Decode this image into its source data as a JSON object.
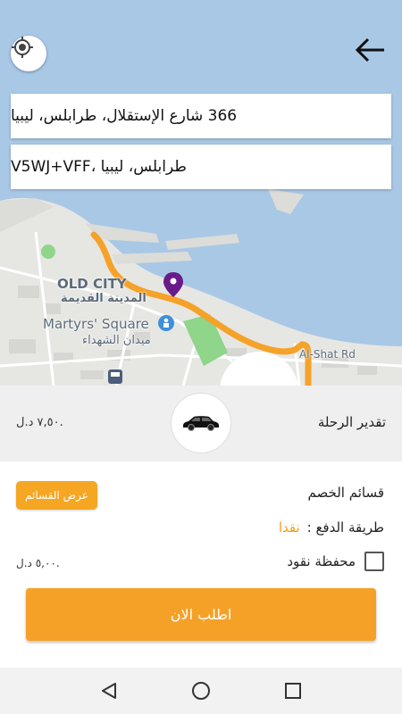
{
  "map": {
    "labels": {
      "old_city_en": "OLD CITY",
      "old_city_ar": "المدينة القديمة",
      "martyrs_en": "Martyrs' Square",
      "martyrs_ar": "ميدان الشهداء",
      "street": "Al-Shat Rd"
    },
    "route_color": "#f5a228",
    "pin_color": "#6a1b8a",
    "locate_icon": "crosshair-icon",
    "back_icon": "arrow-right-icon"
  },
  "addresses": {
    "from": "366 شارع الإستقلال، طرابلس، ليبيا",
    "to": "V5WJ+VFF، طرابلس، ليبيا"
  },
  "estimate": {
    "title": "تقدير الرحلة",
    "price": "٧,٥٠ د.ل."
  },
  "panel": {
    "discount_label": "قسائم الخصم",
    "show_vouchers_button": "عرض القسائم",
    "payment_label": "طريقة الدفع :",
    "payment_value": "نقدا",
    "wallet_label": "محفظة نقود",
    "wallet_amount": "٥,٠٠ د.ل.",
    "order_button": "اطلب الان"
  },
  "colors": {
    "accent": "#f5a128",
    "panel_gray": "#efefef"
  }
}
